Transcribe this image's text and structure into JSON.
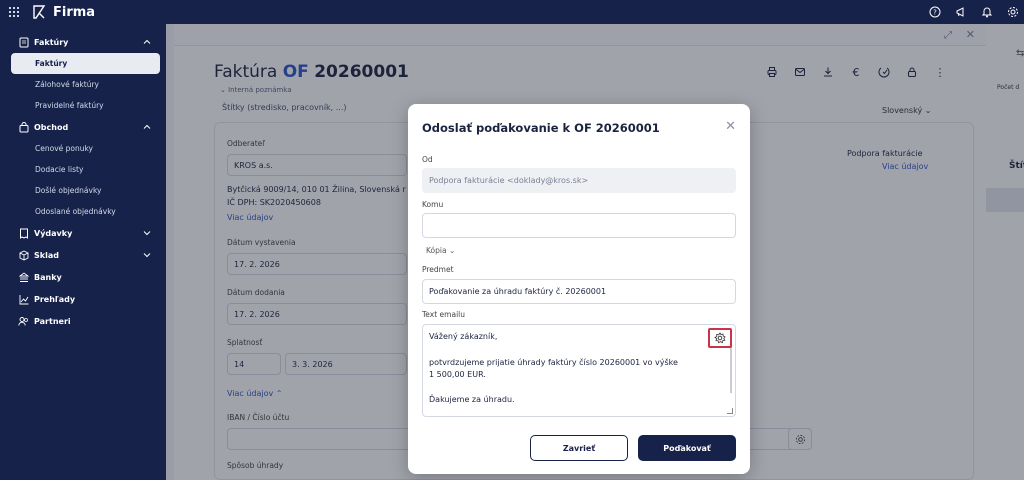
{
  "app": {
    "name": "Firma"
  },
  "topbar": {
    "icons": [
      "help-icon",
      "megaphone-icon",
      "bell-icon",
      "settings-icon"
    ]
  },
  "sidebar": {
    "sections": [
      {
        "label": "Faktúry",
        "icon": "invoice-icon",
        "expanded": true,
        "items": [
          "Faktúry",
          "Zálohové faktúry",
          "Pravidelné faktúry"
        ],
        "active": "Faktúry"
      },
      {
        "label": "Obchod",
        "icon": "bag-icon",
        "expanded": true,
        "items": [
          "Cenové ponuky",
          "Dodacie listy",
          "Došlé objednávky",
          "Odoslané objednávky"
        ]
      },
      {
        "label": "Výdavky",
        "icon": "receipt-icon",
        "expanded": false
      },
      {
        "label": "Sklad",
        "icon": "box-icon",
        "expanded": false
      },
      {
        "label": "Banky",
        "icon": "bank-icon",
        "expanded": false
      },
      {
        "label": "Prehľady",
        "icon": "chart-icon",
        "expanded": false
      },
      {
        "label": "Partneri",
        "icon": "people-icon",
        "expanded": false
      }
    ]
  },
  "invoice": {
    "title_prefix": "Faktúra",
    "title_code": "OF",
    "title_number": "20260001",
    "internal_note": "Interná poznámka",
    "tags": "Štítky (stredisko, pracovník, ...)",
    "language": "Slovenský",
    "customer_label": "Odberateľ",
    "customer_name": "KROS a.s.",
    "customer_address": "Bytčická 9009/14, 010 01 Žilina, Slovenská r",
    "customer_vat": "IČ DPH: SK2020450608",
    "more_info": "Viac údajov",
    "issue_date_label": "Dátum vystavenia",
    "issue_date": "17. 2. 2026",
    "delivery_date_label": "Dátum dodania",
    "delivery_date": "17. 2. 2026",
    "due_label": "Splatnosť",
    "due_days": "14",
    "due_date": "3. 3. 2026",
    "more_info_open": "Viac údajov",
    "iban_label": "IBAN / Číslo účtu",
    "payment_label": "Spôsob úhrady",
    "supplier_name": "Podpora fakturácie",
    "supplier_more": "Viac údajov"
  },
  "right_strip": {
    "text1": "Počet d",
    "text2": "Štít"
  },
  "modal": {
    "title": "Odoslať poďakovanie k OF 20260001",
    "from_label": "Od",
    "from_value": "Podpora fakturácie <doklady@kros.sk>",
    "to_label": "Komu",
    "to_value": "",
    "copy_label": "Kópia",
    "subject_label": "Predmet",
    "subject_value": "Poďakovanie za úhradu faktúry č. 20260001",
    "body_label": "Text emailu",
    "body_lines": [
      "Vážený zákazník,",
      "potvrdzujeme prijatie úhrady faktúry číslo 20260001 vo výške",
      "1 500,00 EUR.",
      "Ďakujeme za úhradu."
    ],
    "cancel_label": "Zavrieť",
    "send_label": "Poďakovať"
  }
}
